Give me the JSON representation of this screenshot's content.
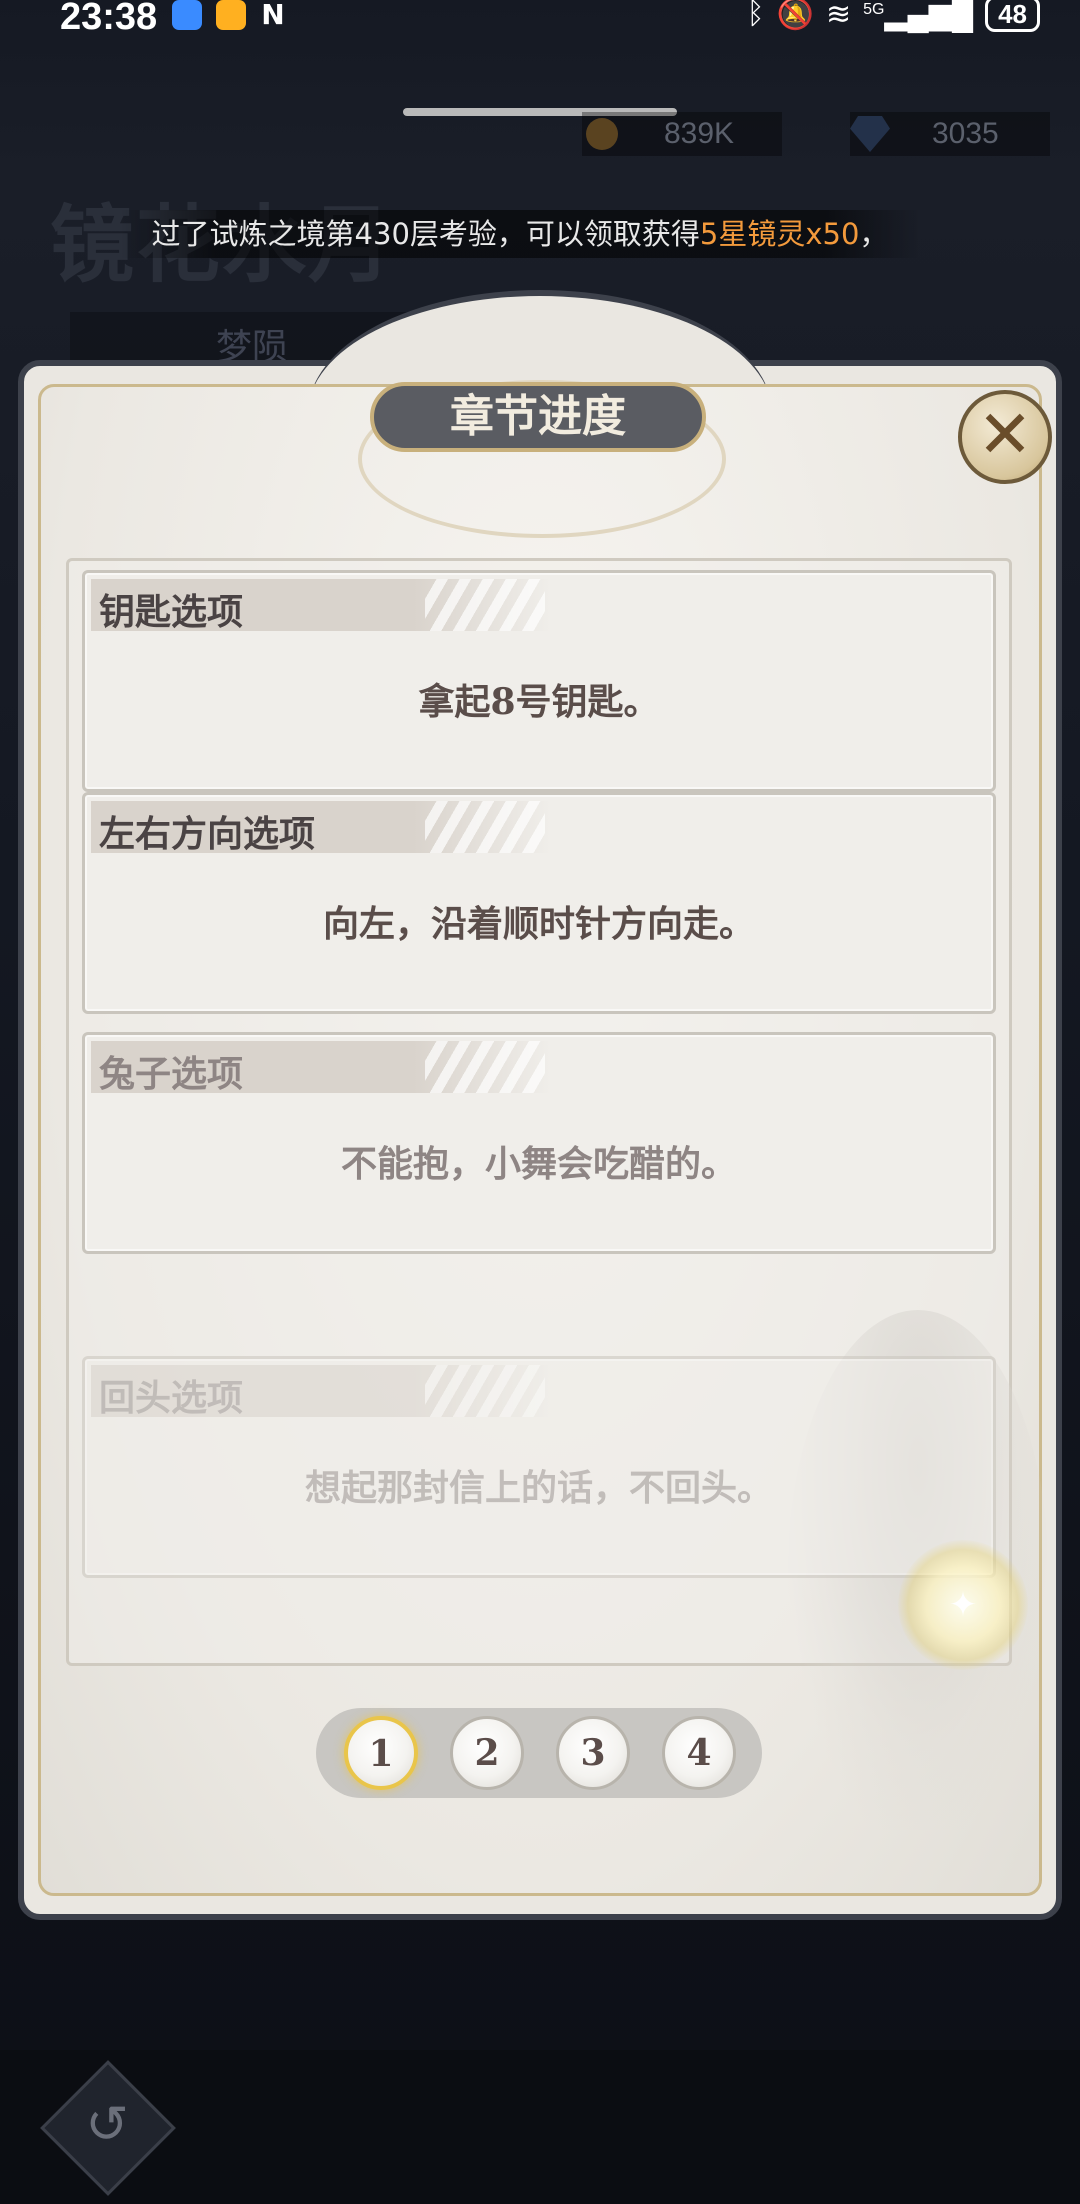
{
  "status_bar": {
    "time": "23:38",
    "app_icons": [
      "chat-app",
      "game-app",
      "nfc"
    ],
    "nfc_label": "N",
    "network": "5G",
    "battery": "48"
  },
  "top_bar": {
    "gold": "839K",
    "gems": "3035"
  },
  "background": {
    "title": "镜花水月",
    "subtitle": "梦陨"
  },
  "notice": {
    "text_before": "过了试炼之境第430层考验，可以领取获得",
    "highlight": "5星镜灵x50",
    "text_after": "，",
    "highlight_color": "#f39a3c"
  },
  "dialog": {
    "title": "章节进度",
    "close_label": "✕",
    "cards": [
      {
        "title": "钥匙选项",
        "body": "拿起8号钥匙。"
      },
      {
        "title": "左右方向选项",
        "body": "向左，沿着顺时针方向走。"
      },
      {
        "title": "兔子选项",
        "body": "不能抱，小舞会吃醋的。"
      },
      {
        "title": "回头选项",
        "body": "想起那封信上的话，不回头。"
      }
    ],
    "pages": [
      "1",
      "2",
      "3",
      "4"
    ],
    "active_page": "1"
  },
  "bottom": {
    "back_icon": "↺"
  }
}
